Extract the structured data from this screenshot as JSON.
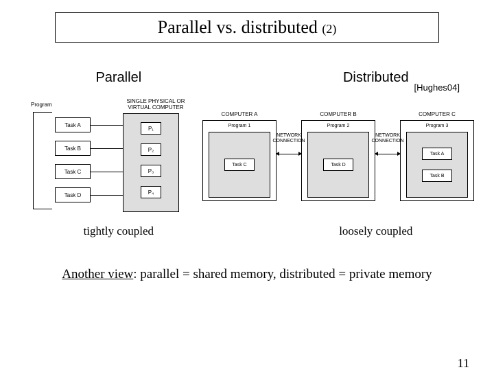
{
  "title": {
    "main": "Parallel vs. distributed ",
    "sub": "(2)"
  },
  "citation": "[Hughes04]",
  "headings": {
    "parallel": "Parallel",
    "distributed": "Distributed"
  },
  "parallel_diagram": {
    "program_label": "Program",
    "computer_label": "SINGLE PHYSICAL OR VIRTUAL COMPUTER",
    "tasks": [
      "Task A",
      "Task B",
      "Task C",
      "Task D"
    ],
    "cpus": [
      "P₁",
      "P₂",
      "P₃",
      "P₄"
    ]
  },
  "distributed_diagram": {
    "computers": [
      {
        "label": "COMPUTER A",
        "program": "Program 1",
        "tasks": [
          "Task C"
        ]
      },
      {
        "label": "COMPUTER B",
        "program": "Program 2",
        "tasks": [
          "Task D"
        ]
      },
      {
        "label": "COMPUTER C",
        "program": "Program 3",
        "tasks": [
          "Task A",
          "Task B"
        ]
      }
    ],
    "network_label": "NETWORK CONNECTION"
  },
  "captions": {
    "parallel": "tightly coupled",
    "distributed": "loosely coupled"
  },
  "footer": {
    "prefix": "Another view",
    "rest": ": parallel = shared memory, distributed = private memory"
  },
  "page_number": "11"
}
